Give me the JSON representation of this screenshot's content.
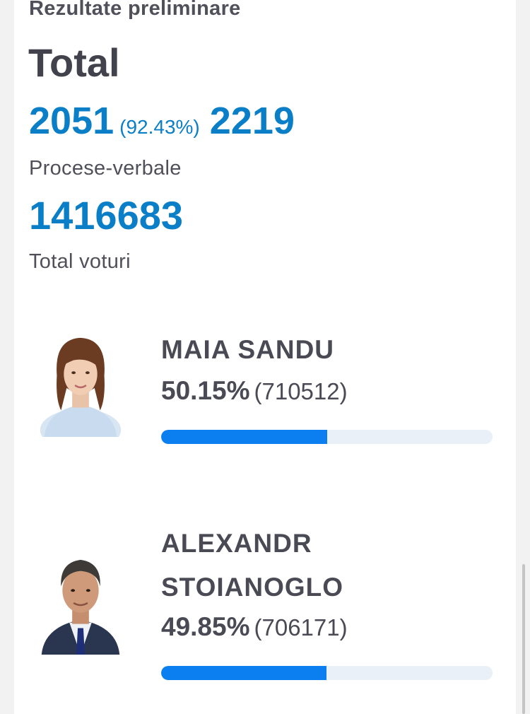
{
  "header": {
    "section_title": "Rezultate preliminare",
    "total_title": "Total"
  },
  "reports": {
    "processed": "2051",
    "processed_pct": "(92.43%)",
    "total": "2219",
    "label": "Procese-verbale"
  },
  "votes": {
    "total": "1416683",
    "label": "Total voturi"
  },
  "candidates": [
    {
      "name": "MAIA SANDU",
      "pct": "50.15%",
      "votes": "(710512)",
      "share": 0.5015,
      "avatar_icon": "candidate-portrait"
    },
    {
      "name": "ALEXANDR STOIANOGLO",
      "name_line1": "ALEXANDR",
      "name_line2": "STOIANOGLO",
      "pct": "49.85%",
      "votes": "(706171)",
      "share": 0.4985,
      "avatar_icon": "candidate-portrait"
    }
  ],
  "colors": {
    "accent": "#0a7fc7",
    "bar_fill": "#0b7ff0",
    "bar_track": "#eaf0f8",
    "text": "#4a4a55"
  }
}
